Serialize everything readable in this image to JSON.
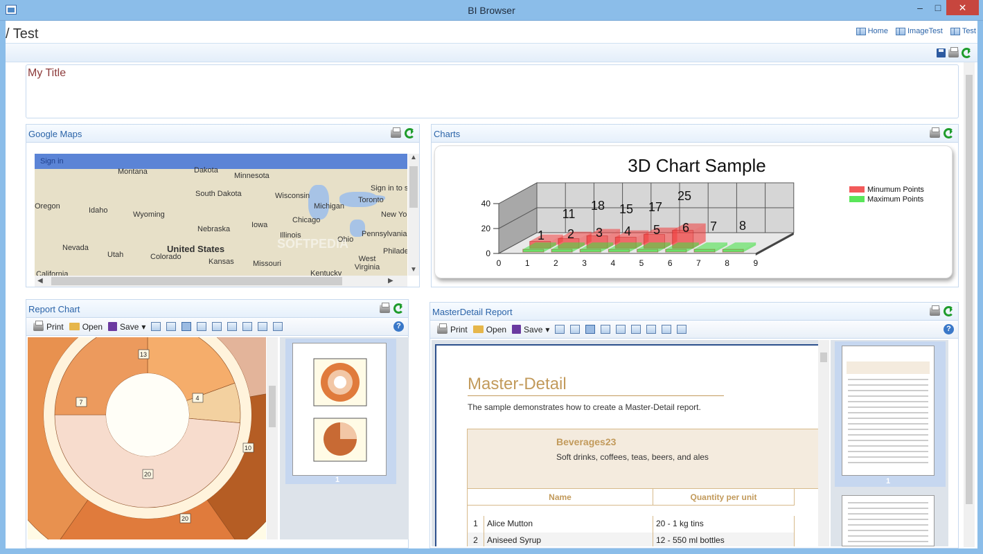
{
  "window": {
    "title": "BI Browser",
    "minimize": "–",
    "maximize": "□",
    "close": "✕"
  },
  "breadcrumb": "/ Test",
  "toplinks": [
    {
      "label": "Home"
    },
    {
      "label": "ImageTest"
    },
    {
      "label": "Test"
    }
  ],
  "title_panel": {
    "text": "My Title"
  },
  "maps": {
    "title": "Google Maps",
    "signin": "Sign in",
    "signin_corner": "Sign in to s",
    "watermark": "SOFTPEDIA",
    "labels": [
      "Montana",
      "Dakota",
      "Minnesota",
      "South Dakota",
      "Wisconsin",
      "Michigan",
      "Toronto",
      "New Yo",
      "Oregon",
      "Idaho",
      "Wyoming",
      "Nebraska",
      "Iowa",
      "Chicago",
      "Pennsylvania",
      "Illinois",
      "Ohio",
      "Nevada",
      "Utah",
      "United States",
      "Colorado",
      "Kansas",
      "Missouri",
      "West Virginia",
      "Philade",
      "California",
      "Kentucky"
    ]
  },
  "charts": {
    "title": "Charts"
  },
  "chart_data": {
    "type": "bar",
    "title": "3D Chart Sample",
    "categories": [
      "1",
      "2",
      "3",
      "4",
      "5",
      "6",
      "7",
      "8"
    ],
    "series": [
      {
        "name": "Minumum Points",
        "values": [
          1,
          2,
          3,
          4,
          5,
          6,
          7,
          8
        ],
        "color": "#f25a5a"
      },
      {
        "name": "Maximum Points",
        "values": [
          11,
          18,
          15,
          17,
          25,
          0,
          0,
          0
        ],
        "color": "#5ae65a"
      }
    ],
    "x_ticks": [
      "0",
      "1",
      "2",
      "3",
      "4",
      "5",
      "6",
      "7",
      "8",
      "9"
    ],
    "y_ticks": [
      "0",
      "20",
      "40"
    ],
    "legend_position": "right",
    "data_labels": [
      {
        "text": "1"
      },
      {
        "text": "11"
      },
      {
        "text": "2"
      },
      {
        "text": "18"
      },
      {
        "text": "3"
      },
      {
        "text": "15"
      },
      {
        "text": "4"
      },
      {
        "text": "17"
      },
      {
        "text": "5"
      },
      {
        "text": "25"
      },
      {
        "text": "6"
      },
      {
        "text": "7"
      },
      {
        "text": "8"
      }
    ]
  },
  "report_chart": {
    "title": "Report Chart",
    "toolbar": {
      "print": "Print",
      "open": "Open",
      "save": "Save"
    },
    "donut_labels": [
      "13",
      "7",
      "4",
      "20",
      "10",
      "20"
    ],
    "thumb_page": "1"
  },
  "master_detail": {
    "title": "MasterDetail Report",
    "toolbar": {
      "print": "Print",
      "open": "Open",
      "save": "Save"
    },
    "page_title": "Master-Detail",
    "description": "The sample demonstrates how to create a Master-Detail report.",
    "category_name": "Beverages23",
    "category_desc": "Soft drinks, coffees, teas, beers, and ales",
    "columns": [
      "Name",
      "Quantity per unit"
    ],
    "rows": [
      {
        "n": "1",
        "name": "Alice Mutton",
        "qty": "20 - 1 kg tins"
      },
      {
        "n": "2",
        "name": "Aniseed Syrup",
        "qty": "12 - 550 ml bottles"
      }
    ],
    "thumb_page": "1"
  }
}
